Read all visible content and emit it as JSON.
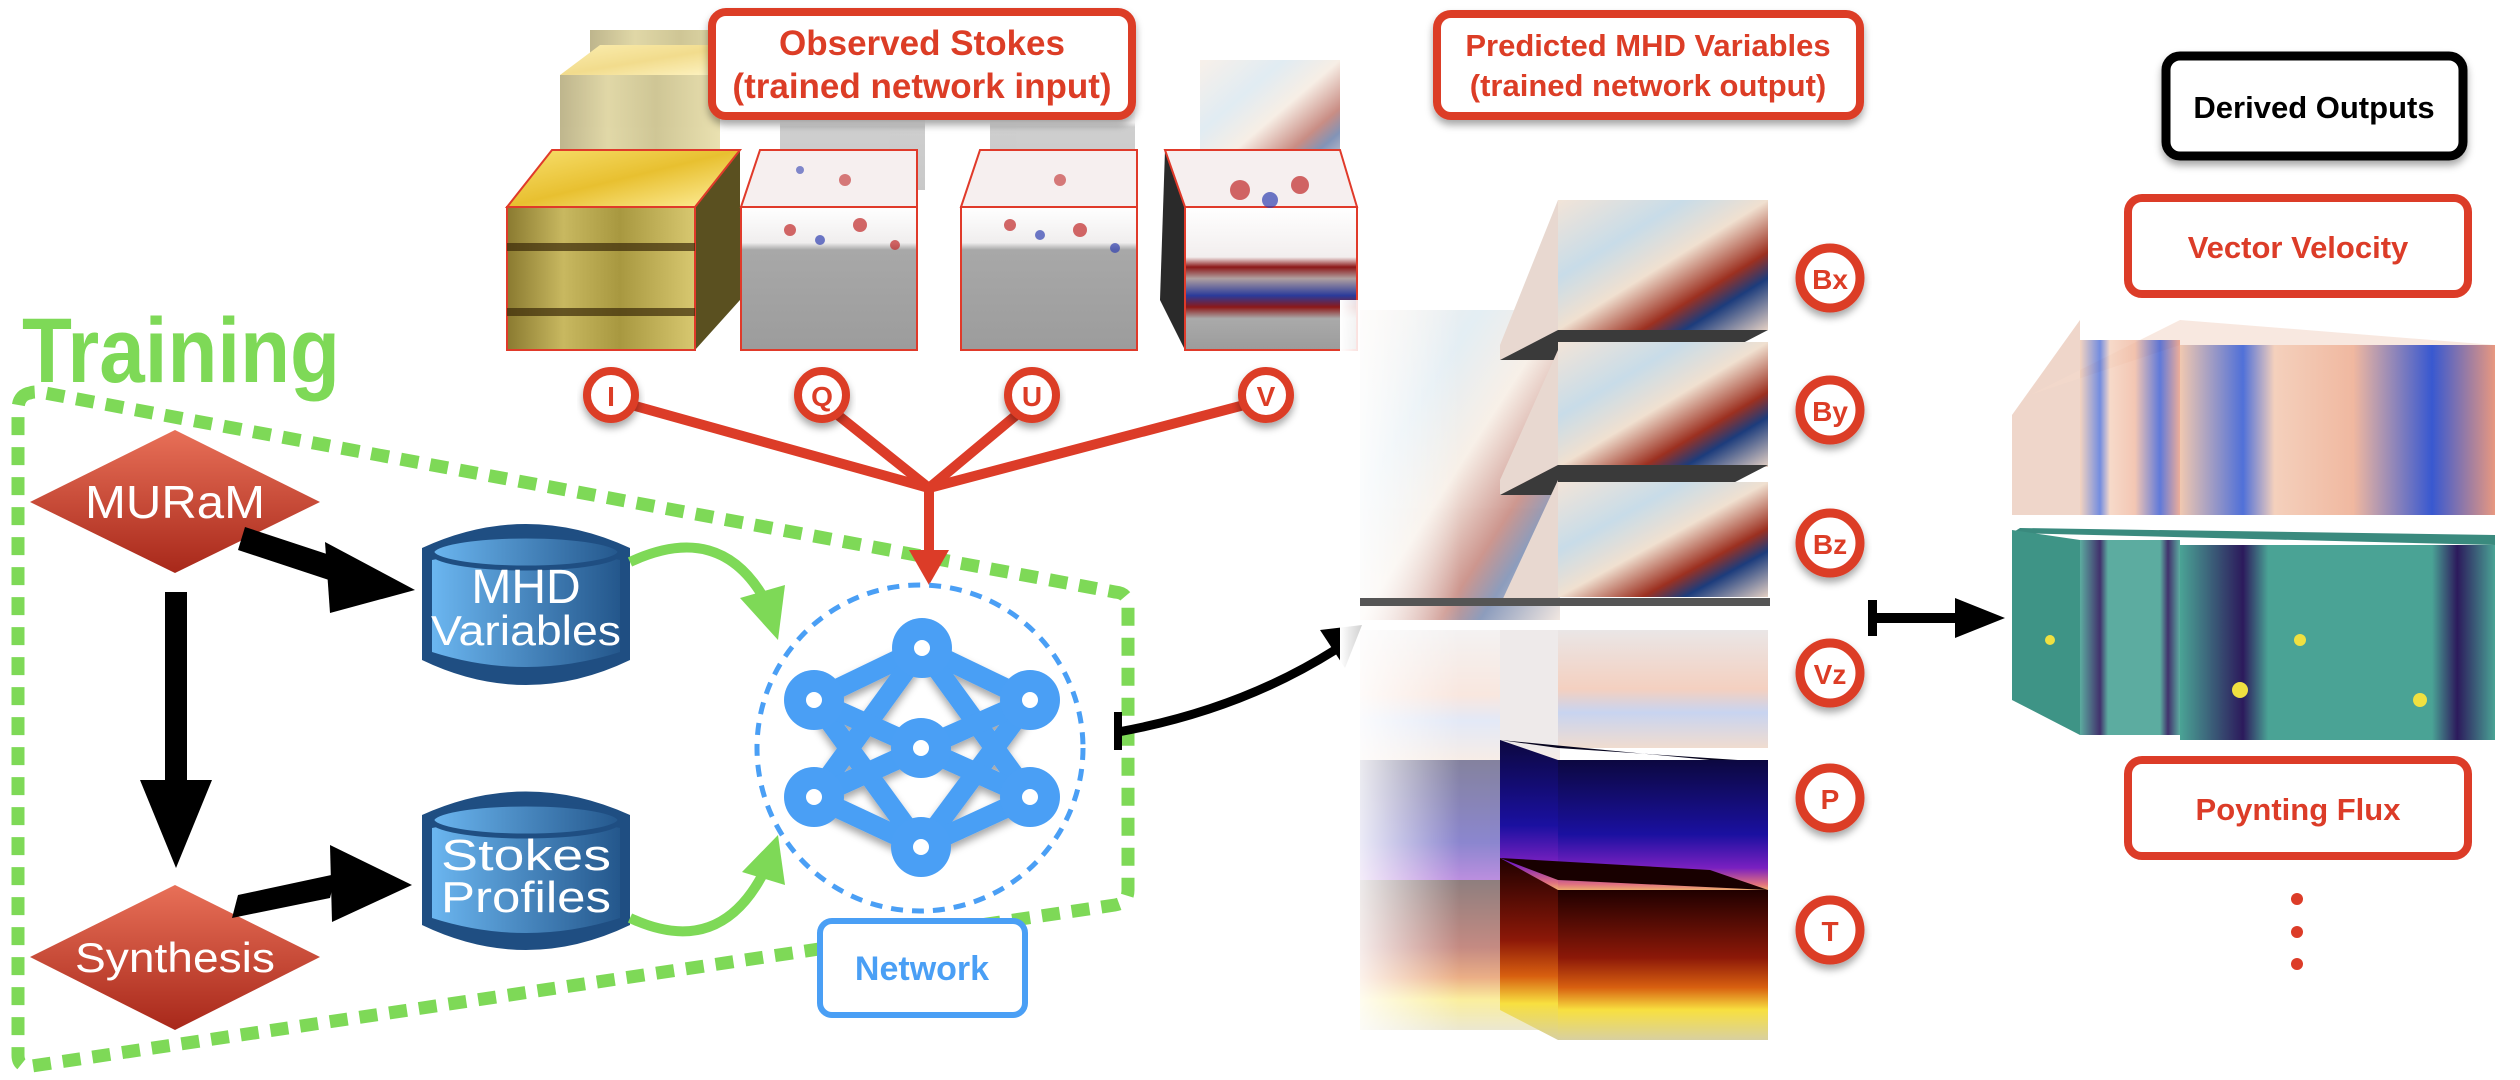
{
  "title_training": "Training",
  "colors": {
    "red": "#dc3c28",
    "green": "#7ed957",
    "blue": "#4a9ff5",
    "dark_blue": "#1f4e82",
    "black": "#000000",
    "teal": "#4aa395"
  },
  "observed_stokes": {
    "line1": "Observed Stokes",
    "line2": "(trained network input)",
    "channels": [
      {
        "label": "I",
        "texture": "intensity-yellow"
      },
      {
        "label": "Q",
        "texture": "red-blue-diverging"
      },
      {
        "label": "U",
        "texture": "red-blue-diverging"
      },
      {
        "label": "V",
        "texture": "red-blue-diverging"
      }
    ]
  },
  "predicted": {
    "line1": "Predicted MHD Variables",
    "line2": "(trained network output)",
    "variables": [
      {
        "label": "Bx",
        "texture": "red-blue-diverging"
      },
      {
        "label": "By",
        "texture": "red-blue-diverging"
      },
      {
        "label": "Bz",
        "texture": "red-blue-diverging"
      },
      {
        "label": "Vz",
        "texture": "red-blue-soft"
      },
      {
        "label": "P",
        "texture": "plasma"
      },
      {
        "label": "T",
        "texture": "hot"
      }
    ]
  },
  "training": {
    "muram": "MURaM",
    "synthesis": "Synthesis",
    "mhd_db": {
      "line1": "MHD",
      "line2": "Variables"
    },
    "stokes_db": {
      "line1": "Stokes",
      "line2": "Profiles"
    },
    "network_label": "Network"
  },
  "derived": {
    "header": "Derived Outputs",
    "items": [
      "Vector Velocity",
      "Poynting Flux"
    ],
    "ellipsis": "⋮"
  }
}
